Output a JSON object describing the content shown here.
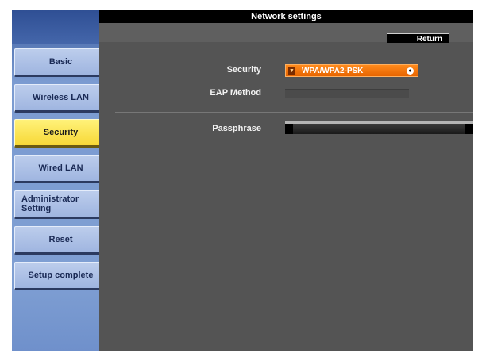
{
  "window": {
    "title": "Network settings"
  },
  "toolbar": {
    "return_label": "Return"
  },
  "sidebar": {
    "items": [
      {
        "label": "Basic"
      },
      {
        "label": "Wireless LAN"
      },
      {
        "label": "Security"
      },
      {
        "label": "Wired LAN"
      },
      {
        "label": "Administrator Setting"
      },
      {
        "label": "Reset"
      },
      {
        "label": "Setup complete"
      }
    ],
    "active_item": "Security"
  },
  "form": {
    "security_label": "Security",
    "security_value": "WPA/WPA2-PSK",
    "eap_method_label": "EAP Method",
    "eap_method_value": "",
    "passphrase_label": "Passphrase",
    "passphrase_value": ""
  },
  "colors": {
    "accent_orange": "#f07a10",
    "active_yellow": "#f7d836",
    "nav_blue": "#9fb5e0",
    "panel_gray": "#545454"
  }
}
